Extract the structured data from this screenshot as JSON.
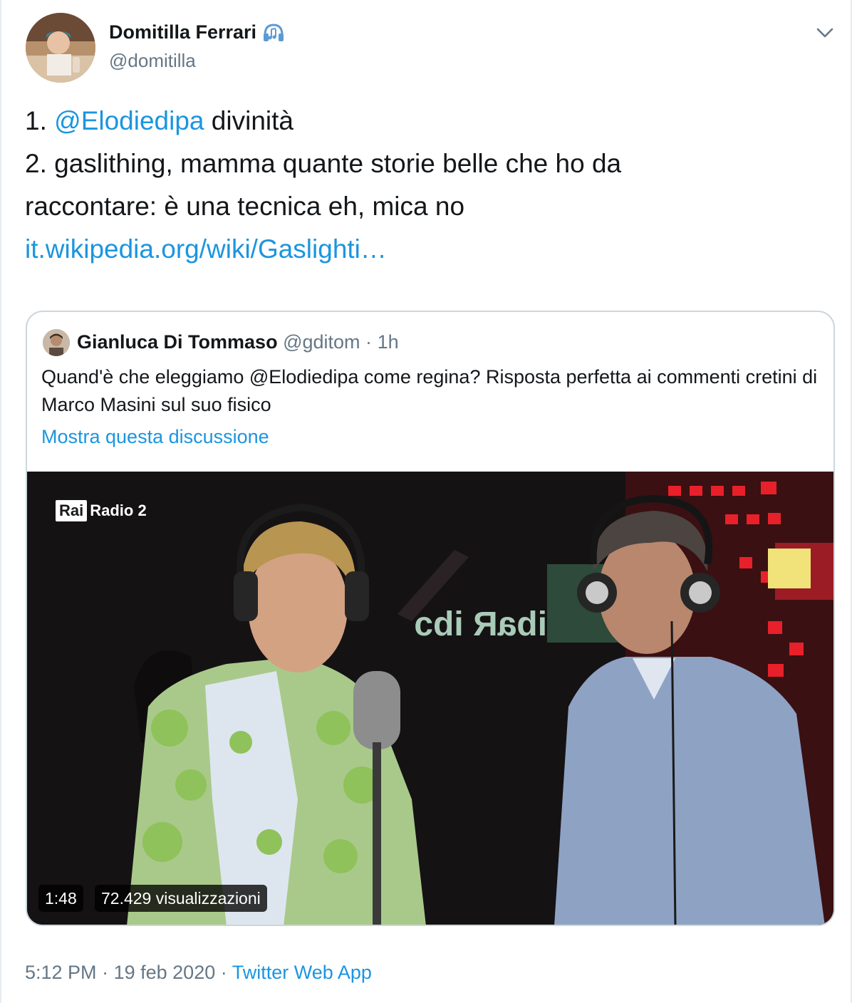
{
  "tweet": {
    "author_name": "Domitilla Ferrari",
    "author_emoji": "headphone-icon",
    "handle": "@domitilla",
    "text_line1_num": "1.",
    "text_line1_mention": "@Elodiedipa",
    "text_line1_rest": "divinità",
    "text_line2": "2. gaslithing, mamma quante storie belle che ho da",
    "text_line3": "raccontare: è una tecnica eh, mica no",
    "link": "it.wikipedia.org/wiki/Gaslighti…"
  },
  "quoted": {
    "author_name": "Gianluca Di Tommaso",
    "handle": "@gditom",
    "separator": "·",
    "time": "1h",
    "text": "Quand'è che eleggiamo @Elodiedipa come regina? Risposta perfetta ai commenti cretini di Marco Masini sul suo fisico",
    "show_thread": "Mostra questa discussione",
    "video": {
      "logo_box": "Rai",
      "logo_text": "Radio 2",
      "duration": "1:48",
      "views": "72.429 visualizzazioni"
    }
  },
  "footer": {
    "time": "5:12 PM",
    "sep1": "·",
    "date": "19 feb 2020",
    "sep2": "·",
    "app": "Twitter Web App"
  },
  "colors": {
    "link": "#1b95e0",
    "secondary": "#657786",
    "border": "#ccd6dd"
  }
}
